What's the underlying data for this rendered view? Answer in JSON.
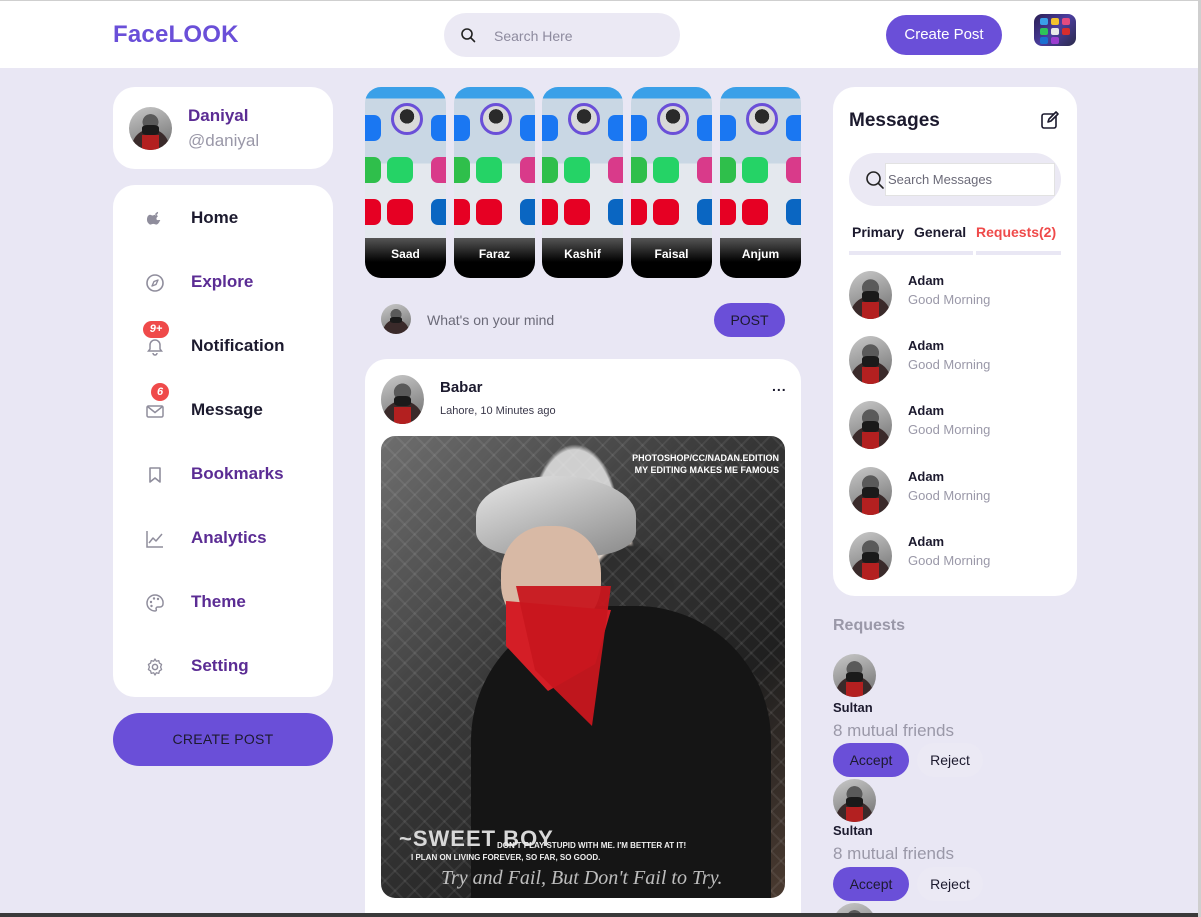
{
  "header": {
    "logo": "FaceLOOK",
    "search_placeholder": "Search Here",
    "create_post_label": "Create Post"
  },
  "profile": {
    "name": "Daniyal",
    "handle": "@daniyal"
  },
  "sidebar": {
    "items": [
      {
        "label": "Home",
        "icon": "home-icon"
      },
      {
        "label": "Explore",
        "icon": "compass-icon"
      },
      {
        "label": "Notification",
        "icon": "bell-icon",
        "badge": "9+"
      },
      {
        "label": "Message",
        "icon": "mail-icon",
        "badge": "6"
      },
      {
        "label": "Bookmarks",
        "icon": "bookmark-icon"
      },
      {
        "label": "Analytics",
        "icon": "chart-icon"
      },
      {
        "label": "Theme",
        "icon": "palette-icon"
      },
      {
        "label": "Setting",
        "icon": "gear-icon"
      }
    ],
    "create_post_label": "CREATE POST"
  },
  "stories": [
    {
      "name": "Saad"
    },
    {
      "name": "Faraz"
    },
    {
      "name": "Kashif"
    },
    {
      "name": "Faisal"
    },
    {
      "name": "Anjum"
    }
  ],
  "composer": {
    "placeholder": "What's on your mind",
    "post_label": "POST"
  },
  "feed": {
    "author": "Babar",
    "meta": "Lahore, 10 Minutes ago",
    "more": "...",
    "watermark_top": "PHOTOSHOP/CC/NADAN.EDITION",
    "watermark_top2": "MY EDITING MAKES ME FAMOUS",
    "watermark_title": "~SWEET BOY",
    "watermark_line1": "DON'T PLAY STUPID WITH ME. I'M BETTER AT IT!",
    "watermark_line2": "I PLAN ON LIVING FOREVER, SO FAR, SO GOOD.",
    "watermark_script": "Try and Fail, But Don't Fail to Try."
  },
  "messages": {
    "title": "Messages",
    "search_placeholder": "Search Messages",
    "tabs": [
      "Primary",
      "General",
      "Requests(2)"
    ],
    "items": [
      {
        "name": "Adam",
        "text": "Good Morning"
      },
      {
        "name": "Adam",
        "text": "Good Morning"
      },
      {
        "name": "Adam",
        "text": "Good Morning"
      },
      {
        "name": "Adam",
        "text": "Good Morning"
      },
      {
        "name": "Adam",
        "text": "Good Morning"
      }
    ]
  },
  "requests": {
    "title": "Requests",
    "items": [
      {
        "name": "Sultan",
        "mutual": "8 mutual friends",
        "accept": "Accept",
        "reject": "Reject"
      },
      {
        "name": "Sultan",
        "mutual": "8 mutual friends",
        "accept": "Accept",
        "reject": "Reject"
      }
    ]
  },
  "colors": {
    "accent": "#6a4fd8",
    "background": "#e9e7f4",
    "badge": "#ef4a4a",
    "nav_purple": "#5b2c94"
  }
}
